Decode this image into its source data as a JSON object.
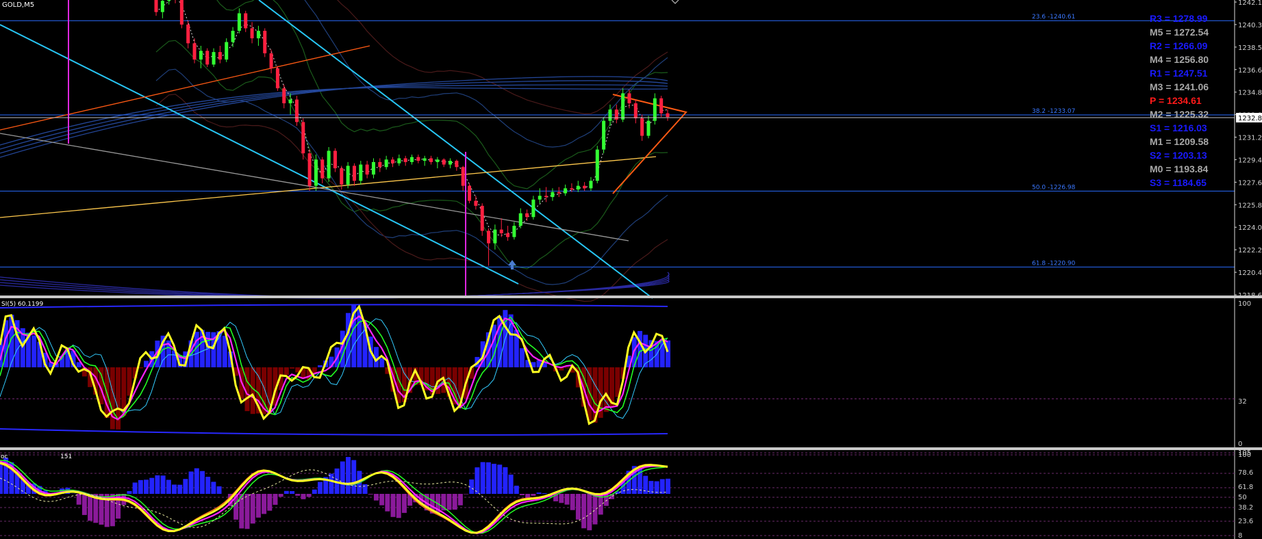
{
  "symbol": "GOLD,M5",
  "colors": {
    "background": "#000000",
    "bull": "#33ff33",
    "bear": "#ff2040",
    "fib": "#2a6cff",
    "trend_cyan": "#27c6f4",
    "trend_orange": "#ff5a14",
    "trend_yellow": "#ffc94d",
    "trend_gray": "#9a9a9a",
    "vline": "#e026e0",
    "pivot_blue": "#1a1aff",
    "pivot_gray": "#a8a8a8",
    "pivot_red": "#ff1a1a",
    "hist_pos": "#2323ff",
    "hist_neg_rsi": "#7a0000",
    "hist_neg_stoch": "#8a1a9a",
    "osc_yellow": "#ffff22",
    "osc_magenta": "#ff22ff",
    "osc_green": "#22ff22",
    "osc_cyan": "#33ccff",
    "osc_orange": "#ff7a1a"
  },
  "price_axis": {
    "labels": [
      "1242.1",
      "1240.33",
      "1238.53",
      "1236.68",
      "1234.88",
      "1232.85",
      "1231.28",
      "1229.48",
      "1227.68",
      "1225.88",
      "1224.08",
      "1222.28",
      "1220.48",
      "1218.68"
    ],
    "current": "1232.85"
  },
  "fib_levels": [
    {
      "label": "23.6 -1240.61",
      "price": 1240.61
    },
    {
      "label": "38.2 -1233.07",
      "price": 1233.07
    },
    {
      "label": "50.0 -1226.98",
      "price": 1226.98
    },
    {
      "label": "61.8 -1220.90",
      "price": 1220.9
    }
  ],
  "pivots": [
    {
      "text": "R3 = 1278.99",
      "color": "blue"
    },
    {
      "text": "M5 = 1272.54",
      "color": "gray"
    },
    {
      "text": "R2 = 1266.09",
      "color": "blue"
    },
    {
      "text": "M4 = 1256.80",
      "color": "gray"
    },
    {
      "text": "R1 = 1247.51",
      "color": "blue"
    },
    {
      "text": "M3 = 1241.06",
      "color": "gray"
    },
    {
      "text": "P   = 1234.61",
      "color": "red"
    },
    {
      "text": "M2 = 1225.32",
      "color": "gray"
    },
    {
      "text": "S1 = 1216.03",
      "color": "blue"
    },
    {
      "text": "M1 = 1209.58",
      "color": "gray"
    },
    {
      "text": "S2 = 1203.13",
      "color": "blue"
    },
    {
      "text": "M0 = 1193.84",
      "color": "gray"
    },
    {
      "text": "S3 = 1184.65",
      "color": "blue"
    }
  ],
  "rsi_panel": {
    "label": "SI(5) 60.1199",
    "axis": [
      "100",
      "32",
      "0"
    ]
  },
  "stoch_panel": {
    "label": "oc",
    "label_tail": "151",
    "axis": [
      "105",
      "100",
      "78.6",
      "61.8",
      "50",
      "38.2",
      "23.6",
      "8"
    ]
  },
  "chart_data": {
    "type": "candlestick",
    "ylim": [
      1218.68,
      1242.1
    ],
    "candles": [
      [
        1242.4,
        1243.2,
        1241.0,
        1241.3
      ],
      [
        1241.3,
        1242.6,
        1240.8,
        1242.2
      ],
      [
        1242.2,
        1243.4,
        1241.9,
        1243.0
      ],
      [
        1243.0,
        1243.6,
        1242.0,
        1242.4
      ],
      [
        1242.4,
        1242.5,
        1240.0,
        1240.3
      ],
      [
        1240.3,
        1240.6,
        1238.4,
        1238.8
      ],
      [
        1238.8,
        1239.2,
        1237.2,
        1237.5
      ],
      [
        1237.5,
        1238.6,
        1236.8,
        1238.2
      ],
      [
        1238.2,
        1238.4,
        1236.9,
        1237.1
      ],
      [
        1237.1,
        1238.4,
        1236.9,
        1238.1
      ],
      [
        1238.1,
        1238.6,
        1237.2,
        1237.5
      ],
      [
        1237.5,
        1239.2,
        1237.3,
        1238.9
      ],
      [
        1238.9,
        1240.1,
        1238.5,
        1239.8
      ],
      [
        1239.8,
        1241.6,
        1239.6,
        1241.2
      ],
      [
        1241.2,
        1241.4,
        1239.7,
        1240.0
      ],
      [
        1240.0,
        1240.5,
        1238.8,
        1239.2
      ],
      [
        1239.2,
        1240.2,
        1238.6,
        1239.8
      ],
      [
        1239.8,
        1240.0,
        1237.7,
        1238.0
      ],
      [
        1238.0,
        1238.3,
        1236.4,
        1236.8
      ],
      [
        1236.8,
        1237.0,
        1235.0,
        1235.2
      ],
      [
        1235.2,
        1235.5,
        1233.6,
        1234.0
      ],
      [
        1234.0,
        1234.8,
        1233.1,
        1234.3
      ],
      [
        1234.3,
        1234.6,
        1232.2,
        1232.5
      ],
      [
        1232.5,
        1232.8,
        1229.5,
        1230.0
      ],
      [
        1230.0,
        1230.3,
        1227.0,
        1227.4
      ],
      [
        1227.4,
        1229.9,
        1227.0,
        1229.5
      ],
      [
        1229.5,
        1229.7,
        1227.6,
        1228.0
      ],
      [
        1228.0,
        1230.5,
        1227.7,
        1230.2
      ],
      [
        1230.2,
        1230.4,
        1228.5,
        1228.8
      ],
      [
        1228.8,
        1229.0,
        1227.1,
        1227.5
      ],
      [
        1227.5,
        1229.3,
        1227.2,
        1229.0
      ],
      [
        1229.0,
        1229.2,
        1227.4,
        1227.8
      ],
      [
        1227.8,
        1229.4,
        1227.5,
        1229.1
      ],
      [
        1229.1,
        1229.4,
        1228.0,
        1228.3
      ],
      [
        1228.3,
        1229.6,
        1228.0,
        1229.3
      ],
      [
        1229.3,
        1229.6,
        1228.5,
        1228.9
      ],
      [
        1228.9,
        1229.8,
        1228.7,
        1229.5
      ],
      [
        1229.5,
        1229.7,
        1228.9,
        1229.2
      ],
      [
        1229.2,
        1229.9,
        1229.0,
        1229.6
      ],
      [
        1229.6,
        1229.8,
        1229.0,
        1229.3
      ],
      [
        1229.3,
        1229.9,
        1229.1,
        1229.7
      ],
      [
        1229.7,
        1229.9,
        1229.2,
        1229.4
      ],
      [
        1229.4,
        1229.8,
        1229.0,
        1229.6
      ],
      [
        1229.6,
        1229.8,
        1229.1,
        1229.3
      ],
      [
        1229.3,
        1229.7,
        1228.8,
        1229.5
      ],
      [
        1229.5,
        1229.6,
        1228.9,
        1229.1
      ],
      [
        1229.1,
        1229.6,
        1228.8,
        1229.4
      ],
      [
        1229.4,
        1229.5,
        1228.6,
        1228.9
      ],
      [
        1228.9,
        1229.0,
        1227.0,
        1227.4
      ],
      [
        1227.4,
        1227.6,
        1226.0,
        1226.2
      ],
      [
        1226.2,
        1226.6,
        1225.5,
        1225.8
      ],
      [
        1225.8,
        1226.0,
        1223.4,
        1223.8
      ],
      [
        1223.8,
        1224.0,
        1221.0,
        1222.8
      ],
      [
        1222.8,
        1224.3,
        1222.3,
        1223.9
      ],
      [
        1223.9,
        1224.8,
        1223.3,
        1223.6
      ],
      [
        1223.6,
        1224.2,
        1223.0,
        1223.3
      ],
      [
        1223.3,
        1224.5,
        1223.1,
        1224.2
      ],
      [
        1224.2,
        1225.6,
        1224.0,
        1225.2
      ],
      [
        1225.2,
        1225.5,
        1224.6,
        1224.9
      ],
      [
        1224.9,
        1226.6,
        1224.7,
        1226.3
      ],
      [
        1226.3,
        1227.2,
        1226.0,
        1226.6
      ],
      [
        1226.6,
        1227.3,
        1226.1,
        1226.5
      ],
      [
        1226.5,
        1227.2,
        1226.2,
        1226.9
      ],
      [
        1226.9,
        1227.3,
        1226.5,
        1226.8
      ],
      [
        1226.8,
        1227.5,
        1226.6,
        1227.2
      ],
      [
        1227.2,
        1227.6,
        1226.9,
        1227.1
      ],
      [
        1227.1,
        1227.8,
        1226.9,
        1227.4
      ],
      [
        1227.4,
        1227.7,
        1227.0,
        1227.2
      ],
      [
        1227.2,
        1228.1,
        1227.0,
        1227.8
      ],
      [
        1227.8,
        1230.6,
        1227.6,
        1230.3
      ],
      [
        1230.3,
        1232.9,
        1230.0,
        1232.6
      ],
      [
        1232.6,
        1233.9,
        1232.2,
        1233.5
      ],
      [
        1233.5,
        1233.9,
        1232.4,
        1232.7
      ],
      [
        1232.7,
        1235.2,
        1232.5,
        1234.8
      ],
      [
        1234.8,
        1235.1,
        1233.6,
        1234.0
      ],
      [
        1234.0,
        1234.3,
        1232.4,
        1232.8
      ],
      [
        1232.8,
        1233.1,
        1231.0,
        1231.4
      ],
      [
        1231.4,
        1233.0,
        1231.2,
        1232.6
      ],
      [
        1232.6,
        1234.8,
        1232.3,
        1234.4
      ],
      [
        1234.4,
        1234.6,
        1232.9,
        1233.2
      ],
      [
        1233.2,
        1233.5,
        1232.6,
        1232.9
      ]
    ]
  }
}
